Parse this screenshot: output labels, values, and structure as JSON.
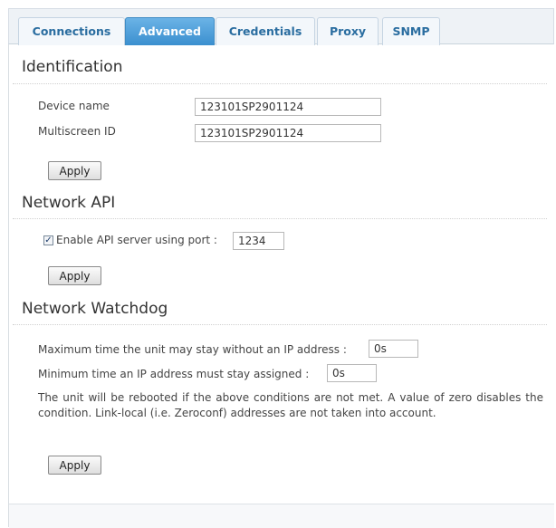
{
  "tabs": [
    {
      "label": "Connections",
      "active": false
    },
    {
      "label": "Advanced",
      "active": true
    },
    {
      "label": "Credentials",
      "active": false
    },
    {
      "label": "Proxy",
      "active": false
    },
    {
      "label": "SNMP",
      "active": false
    }
  ],
  "identification": {
    "title": "Identification",
    "device_name_label": "Device name",
    "device_name_value": "123101SP2901124",
    "multiscreen_label": "Multiscreen ID",
    "multiscreen_value": "123101SP2901124",
    "apply_label": "Apply"
  },
  "network_api": {
    "title": "Network API",
    "enable_label": "Enable API server using port :",
    "enabled": true,
    "port_value": "1234",
    "apply_label": "Apply"
  },
  "watchdog": {
    "title": "Network Watchdog",
    "max_time_label": "Maximum time the unit may stay without an IP address :",
    "max_time_value": "0s",
    "min_time_label": "Minimum time an IP address must stay assigned :",
    "min_time_value": "0s",
    "description": "The unit will be rebooted if the above conditions are not met. A value of zero disables the condition. Link-local (i.e. Zeroconf) addresses are not taken into account.",
    "apply_label": "Apply"
  },
  "colors": {
    "active_tab": "#4d9fd8",
    "tab_text": "#2a6da0"
  }
}
